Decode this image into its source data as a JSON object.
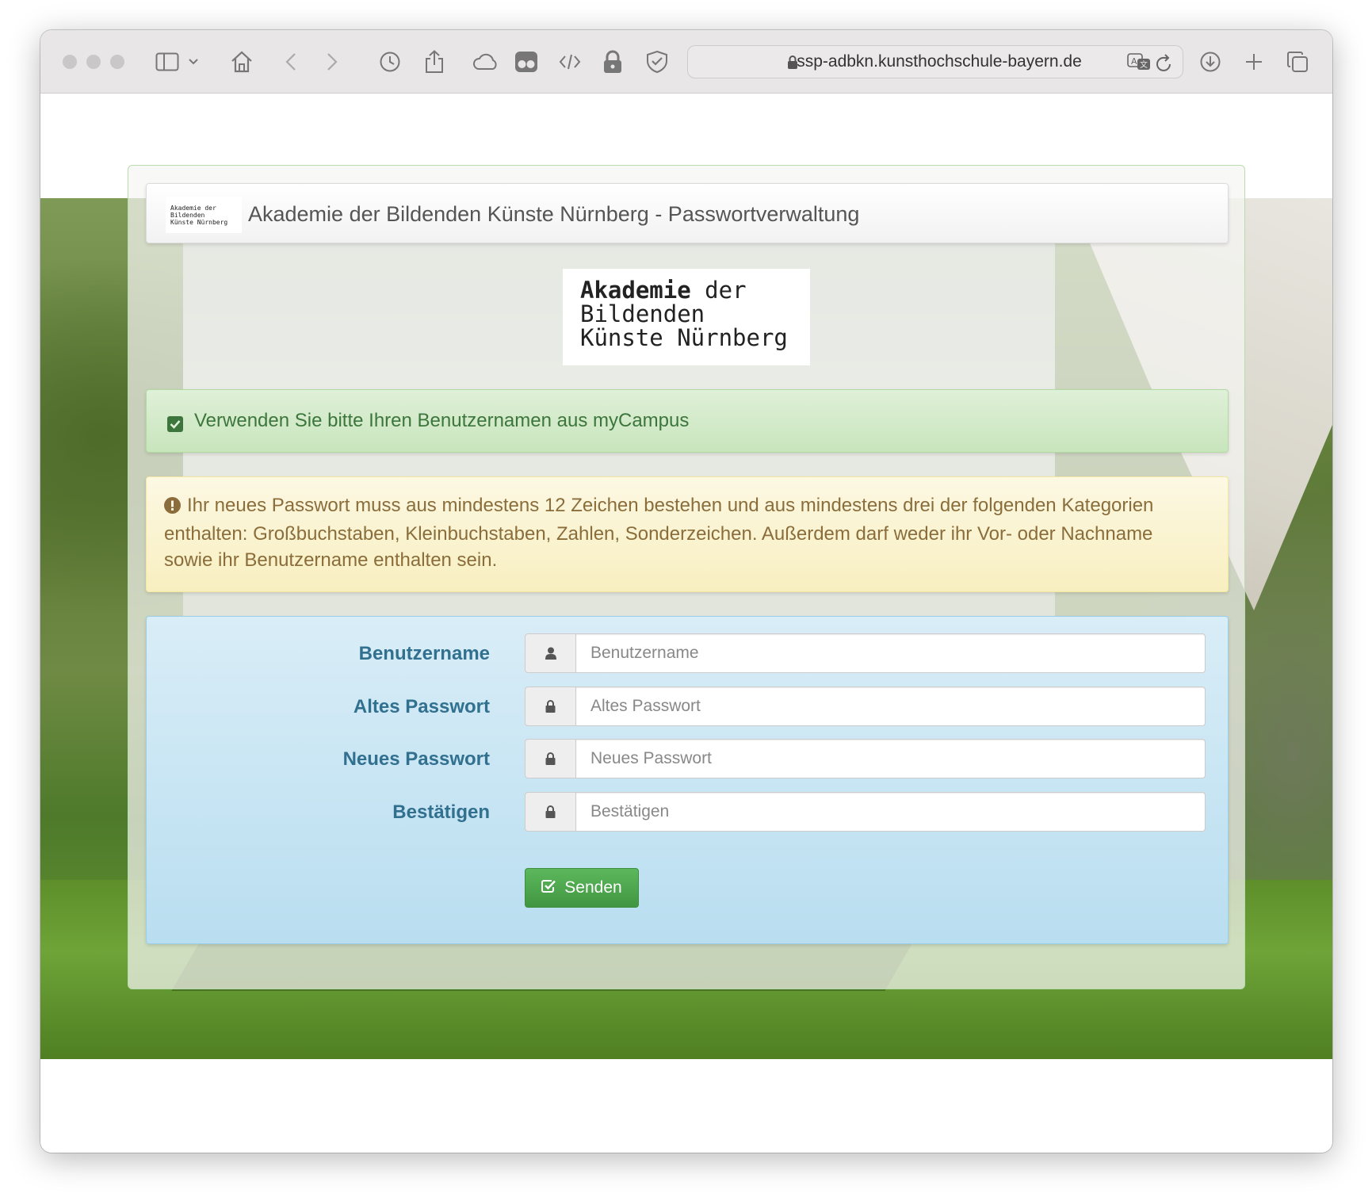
{
  "browser": {
    "url": "ssp-adbkn.kunsthochschule-bayern.de",
    "icons": [
      "sidebar-icon",
      "chevron-down-icon",
      "home-icon",
      "back-icon",
      "forward-icon",
      "history-icon",
      "share-icon",
      "cloud-icon",
      "extension-icon",
      "code-icon",
      "lock-icon",
      "shield-icon",
      "download-icon",
      "new-tab-icon",
      "tabs-overview-icon"
    ]
  },
  "navbar": {
    "logo_lines": [
      "Akademie der",
      "Bildenden",
      "Künste Nürnberg"
    ],
    "title": "Akademie der Bildenden Künste Nürnberg - Passwortverwaltung"
  },
  "logo": {
    "line1_bold": "Akademie",
    "line1_rest": " der",
    "line2": "Bildenden",
    "line3": "Künste Nürnberg"
  },
  "alerts": {
    "success": "Verwenden Sie bitte Ihren Benutzernamen aus myCampus",
    "warning": "Ihr neues Passwort muss aus mindestens 12 Zeichen bestehen und aus mindestens drei der folgenden Kategorien enthalten: Großbuchstaben, Kleinbuchstaben, Zahlen, Sonderzeichen. Außerdem darf weder ihr Vor- oder Nachname sowie ihr Benutzername enthalten sein."
  },
  "form": {
    "fields": [
      {
        "label": "Benutzername",
        "placeholder": "Benutzername",
        "icon": "user-icon"
      },
      {
        "label": "Altes Passwort",
        "placeholder": "Altes Passwort",
        "icon": "lock-icon"
      },
      {
        "label": "Neues Passwort",
        "placeholder": "Neues Passwort",
        "icon": "lock-icon"
      },
      {
        "label": "Bestätigen",
        "placeholder": "Bestätigen",
        "icon": "lock-icon"
      }
    ],
    "submit_label": "Senden"
  },
  "colors": {
    "success_text": "#3c763d",
    "warning_text": "#8a6d3b",
    "label_text": "#31708f",
    "button_green": "#4cae4c"
  }
}
